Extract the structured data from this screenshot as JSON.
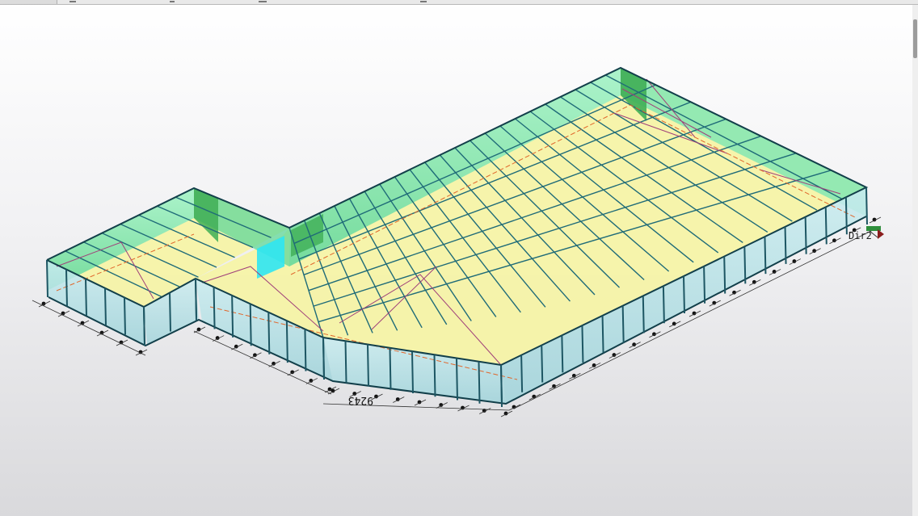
{
  "viewport": {
    "dimension_label": "9243",
    "direction_label": "Dir2"
  },
  "colors": {
    "background_top": "#ffffff",
    "background_bottom": "#d9d9dc",
    "roof_panel": "#f6f3a6",
    "wall_panel": "#86e8c0",
    "wall_panel_dark": "#3fae55",
    "front_wall": "#b9e1e6",
    "steel_member": "#1f6b78",
    "bracing": "#a0407a",
    "axis_line": "#e0662b",
    "selection_cyan": "#2fe5f2"
  },
  "icons": {
    "direction_gizmo": "axis-arrows-icon"
  }
}
